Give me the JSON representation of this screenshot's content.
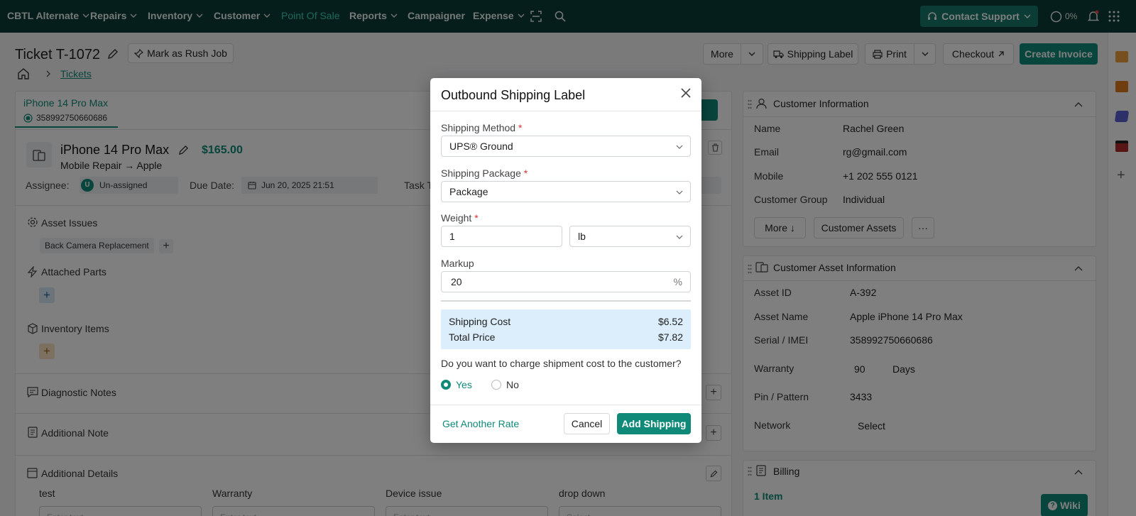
{
  "nav": {
    "brand": "CBTL Alternate",
    "items": [
      {
        "label": "Repairs",
        "dropdown": true
      },
      {
        "label": "Inventory",
        "dropdown": true
      },
      {
        "label": "Customer",
        "dropdown": true
      },
      {
        "label": "Point Of Sale",
        "dropdown": false,
        "active": true
      },
      {
        "label": "Reports",
        "dropdown": true
      },
      {
        "label": "Campaigner",
        "dropdown": false
      },
      {
        "label": "Expense",
        "dropdown": true
      }
    ],
    "support_label": "Contact Support",
    "progress_label": "0%"
  },
  "ticket": {
    "title": "Ticket T-1072",
    "rush_label": "Mark as Rush Job",
    "breadcrumb_tickets": "Tickets",
    "actions": {
      "more": "More",
      "shipping_label": "Shipping Label",
      "print": "Print",
      "checkout": "Checkout",
      "create_invoice": "Create Invoice"
    }
  },
  "device_tab": {
    "name": "iPhone 14 Pro Max",
    "imei": "358992750660686"
  },
  "device": {
    "name": "iPhone 14 Pro Max",
    "price": "$165.00",
    "subtitle": "Mobile Repair → Apple",
    "assignee_label": "Assignee:",
    "assignee_initial": "U",
    "assignee_value": "Un-assigned",
    "due_label": "Due Date:",
    "due_value": "Jun 20, 2025 21:51",
    "task_label": "Task T"
  },
  "sections": {
    "asset_issues": "Asset Issues",
    "issue_chip": "Back Camera Replacement",
    "attached_parts": "Attached Parts",
    "inventory_items": "Inventory Items",
    "diagnostic_notes": "Diagnostic Notes",
    "additional_note": "Additional Note",
    "additional_details": "Additional Details",
    "detail_fields": [
      {
        "label": "test",
        "placeholder": "Enter text"
      },
      {
        "label": "Warranty",
        "placeholder": "Enter text"
      },
      {
        "label": "Device issue",
        "placeholder": "Enter text"
      },
      {
        "label": "drop down",
        "placeholder": "Select"
      }
    ]
  },
  "customer": {
    "title": "Customer Information",
    "rows": [
      {
        "label": "Name",
        "value": "Rachel Green"
      },
      {
        "label": "Email",
        "value": "rg@gmail.com"
      },
      {
        "label": "Mobile",
        "value": "+1 202 555 0121"
      },
      {
        "label": "Customer Group",
        "value": "Individual"
      }
    ],
    "more_label": "More ↓",
    "assets_label": "Customer Assets",
    "ellipsis": "···"
  },
  "asset_info": {
    "title": "Customer Asset Information",
    "rows": [
      {
        "label": "Asset ID",
        "value": "A-392"
      },
      {
        "label": "Asset Name",
        "value": "Apple iPhone 14 Pro Max"
      },
      {
        "label": "Serial / IMEI",
        "value": "358992750660686"
      },
      {
        "label": "Warranty",
        "value": "90"
      },
      {
        "label": "Pin / Pattern",
        "value": "3433"
      },
      {
        "label": "Network",
        "value": "Select"
      }
    ],
    "warranty_unit": "Days"
  },
  "billing": {
    "title": "Billing",
    "items_link": "1 Item",
    "wiki_label": "Wiki"
  },
  "modal": {
    "title": "Outbound Shipping Label",
    "method_label": "Shipping Method",
    "method_value": "UPS® Ground",
    "package_label": "Shipping Package",
    "package_value": "Package",
    "weight_label": "Weight",
    "weight_value": "1",
    "weight_unit": "lb",
    "markup_label": "Markup",
    "markup_value": "20",
    "markup_suffix": "%",
    "required_mark": "*",
    "cost_label": "Shipping Cost",
    "cost_value": "$6.52",
    "total_label": "Total Price",
    "total_value": "$7.82",
    "question": "Do you want to charge shipment cost to the customer?",
    "yes_label": "Yes",
    "no_label": "No",
    "selected": "Yes",
    "rate_link": "Get Another Rate",
    "cancel_label": "Cancel",
    "add_label": "Add Shipping"
  },
  "colors": {
    "nav_bg": "#0b3d36",
    "accent": "#108a78",
    "active_nav": "#3ed3b4",
    "cost_bg": "#dceefb"
  }
}
